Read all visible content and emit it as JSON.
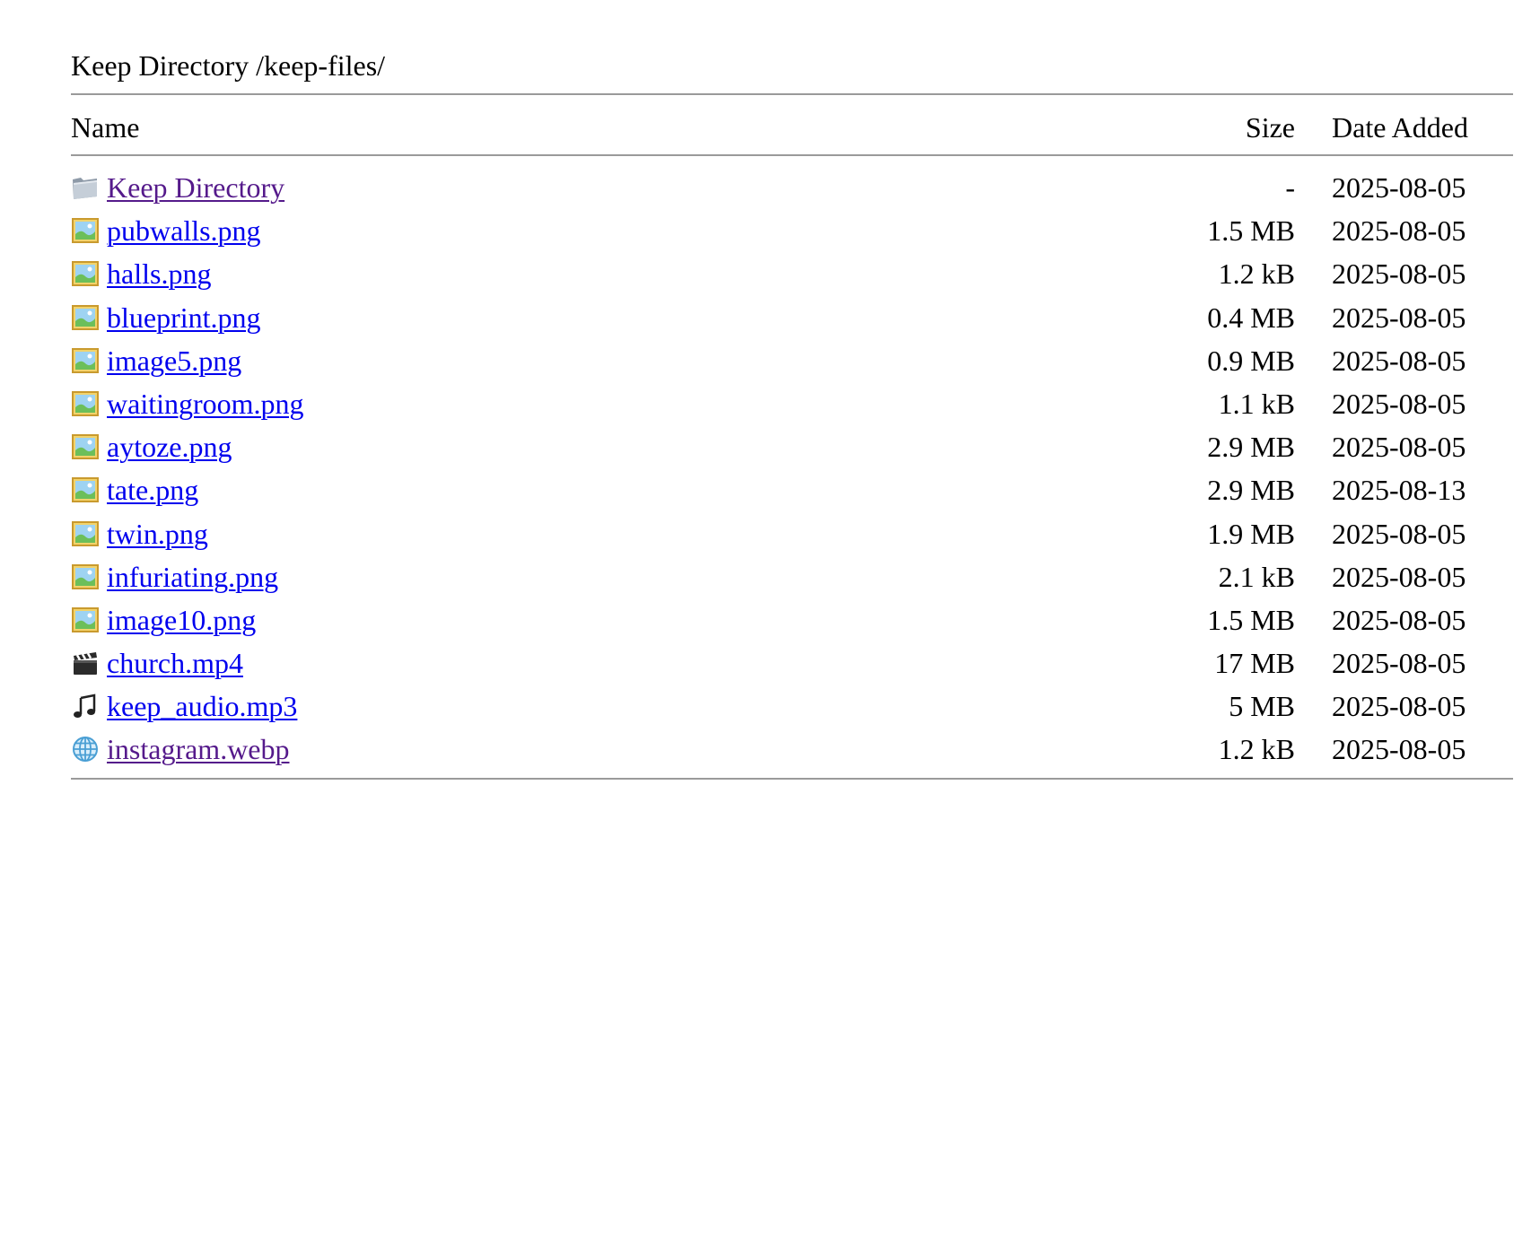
{
  "heading": "Keep Directory /keep-files/",
  "columns": {
    "name": "Name",
    "size": "Size",
    "date": "Date Added"
  },
  "rows": [
    {
      "icon": "folder-icon",
      "name": "Keep Directory",
      "size": "-",
      "date": "2025-08-05",
      "visited": true
    },
    {
      "icon": "image-file-icon",
      "name": "pubwalls.png",
      "size": "1.5 MB",
      "date": "2025-08-05",
      "visited": false
    },
    {
      "icon": "image-file-icon",
      "name": "halls.png",
      "size": "1.2 kB",
      "date": "2025-08-05",
      "visited": false
    },
    {
      "icon": "image-file-icon",
      "name": "blueprint.png",
      "size": "0.4 MB",
      "date": "2025-08-05",
      "visited": false
    },
    {
      "icon": "image-file-icon",
      "name": "image5.png",
      "size": "0.9 MB",
      "date": "2025-08-05",
      "visited": false
    },
    {
      "icon": "image-file-icon",
      "name": "waitingroom.png",
      "size": "1.1 kB",
      "date": "2025-08-05",
      "visited": false
    },
    {
      "icon": "image-file-icon",
      "name": "aytoze.png",
      "size": "2.9 MB",
      "date": "2025-08-05",
      "visited": false
    },
    {
      "icon": "image-file-icon",
      "name": "tate.png",
      "size": "2.9 MB",
      "date": "2025-08-13",
      "visited": false
    },
    {
      "icon": "image-file-icon",
      "name": "twin.png",
      "size": "1.9 MB",
      "date": "2025-08-05",
      "visited": false
    },
    {
      "icon": "image-file-icon",
      "name": "infuriating.png",
      "size": "2.1 kB",
      "date": "2025-08-05",
      "visited": false
    },
    {
      "icon": "image-file-icon",
      "name": "image10.png",
      "size": "1.5 MB",
      "date": "2025-08-05",
      "visited": false
    },
    {
      "icon": "clapperboard-icon",
      "name": "church.mp4",
      "size": "17 MB",
      "date": "2025-08-05",
      "visited": false
    },
    {
      "icon": "music-note-icon",
      "name": "keep_audio.mp3",
      "size": "5 MB",
      "date": "2025-08-05",
      "visited": false
    },
    {
      "icon": "globe-icon",
      "name": "instagram.webp",
      "size": "1.2 kB",
      "date": "2025-08-05",
      "visited": true
    }
  ]
}
